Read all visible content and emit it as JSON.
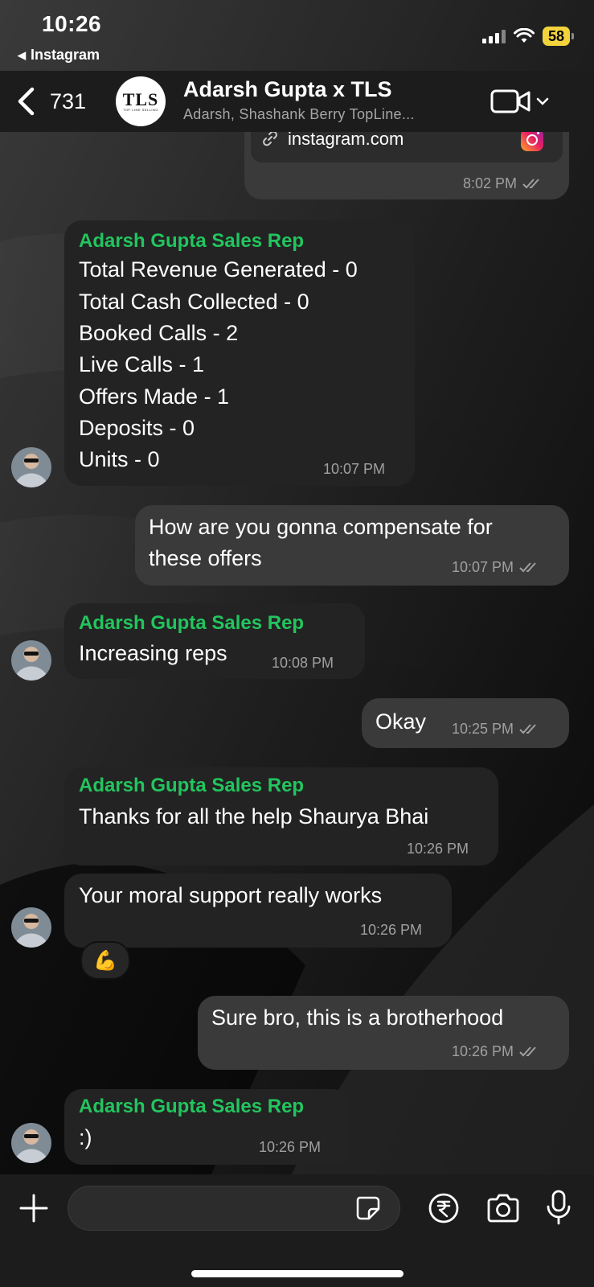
{
  "status_bar": {
    "time": "10:26",
    "back_app": "Instagram",
    "battery": "58"
  },
  "header": {
    "back_count": "731",
    "avatar_logo": "TLS",
    "avatar_logo_sub": "TOP LINE SELLING",
    "title": "Adarsh Gupta x TLS",
    "subtitle": "Adarsh, Shashank Berry TopLine..."
  },
  "messages": [
    {
      "direction": "out",
      "link": "instagram.com",
      "time": "8:02 PM",
      "read": true
    },
    {
      "direction": "in",
      "sender": "Adarsh Gupta Sales Rep",
      "lines": [
        "Total Revenue Generated - 0",
        "Total Cash Collected - 0",
        "Booked Calls - 2",
        "Live Calls - 1",
        "Offers Made - 1",
        "Deposits - 0",
        "Units - 0"
      ],
      "time": "10:07 PM"
    },
    {
      "direction": "out",
      "lines": [
        "How are you gonna compensate for",
        "these offers"
      ],
      "time": "10:07 PM",
      "read": true
    },
    {
      "direction": "in",
      "sender": "Adarsh Gupta Sales Rep",
      "lines": [
        "Increasing reps"
      ],
      "time": "10:08 PM"
    },
    {
      "direction": "out",
      "lines": [
        "Okay"
      ],
      "time": "10:25 PM",
      "read": true
    },
    {
      "direction": "in",
      "sender": "Adarsh Gupta Sales Rep",
      "lines": [
        "Thanks for all the help Shaurya Bhai"
      ],
      "time": "10:26 PM"
    },
    {
      "direction": "in",
      "lines": [
        "Your moral support really works"
      ],
      "time": "10:26 PM",
      "reaction": "💪"
    },
    {
      "direction": "out",
      "lines": [
        "Sure bro, this is a brotherhood"
      ],
      "time": "10:26 PM",
      "read": true
    },
    {
      "direction": "in",
      "sender": "Adarsh Gupta Sales Rep",
      "lines": [
        ":)"
      ],
      "time": "10:26 PM"
    }
  ],
  "composer": {
    "placeholder": ""
  },
  "icons": {
    "back": "chevron-left-icon",
    "video": "video-camera-icon",
    "chevron": "chevron-down-icon",
    "link": "link-icon",
    "instagram": "instagram-icon",
    "plus": "plus-icon",
    "sticker": "sticker-icon",
    "rupee": "rupee-icon",
    "camera": "camera-icon",
    "mic": "microphone-icon"
  },
  "colors": {
    "sender_name": "#22c55e",
    "incoming_bubble": "#232323",
    "outgoing_bubble": "#3a3a3a",
    "header_bg": "#1c1c1c",
    "battery": "#f2d33c"
  }
}
